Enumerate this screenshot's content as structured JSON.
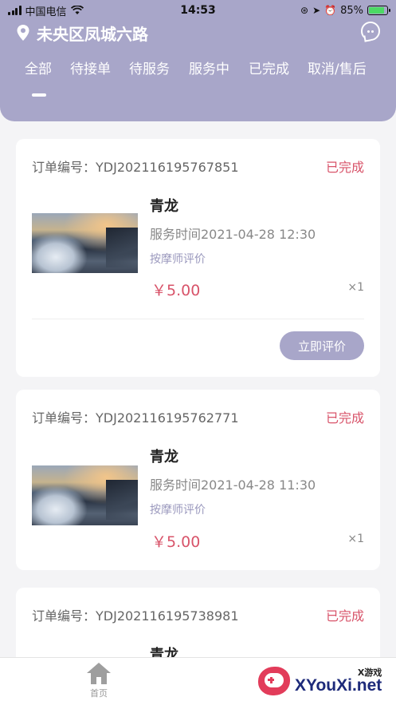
{
  "status_bar": {
    "carrier": "中国电信",
    "time": "14:53",
    "battery": "85%",
    "battery_level": 0.85
  },
  "header": {
    "location": "未央区凤城六路",
    "location_icon": "map-pin-icon",
    "chat_icon": "chat-bubble-icon"
  },
  "tabs": [
    {
      "label": "全部",
      "active": true
    },
    {
      "label": "待接单",
      "active": false
    },
    {
      "label": "待服务",
      "active": false
    },
    {
      "label": "服务中",
      "active": false
    },
    {
      "label": "已完成",
      "active": false
    },
    {
      "label": "取消/售后",
      "active": false
    }
  ],
  "orders": [
    {
      "order_label": "订单编号：YDJ202116195767851",
      "status": "已完成",
      "service_name": "青龙",
      "service_time": "服务时间2021-04-28 12:30",
      "review_link": "按摩师评价",
      "price": "￥5.00",
      "qty": "×1",
      "action": "立即评价"
    },
    {
      "order_label": "订单编号：YDJ202116195762771",
      "status": "已完成",
      "service_name": "青龙",
      "service_time": "服务时间2021-04-28 11:30",
      "review_link": "按摩师评价",
      "price": "￥5.00",
      "qty": "×1"
    },
    {
      "order_label": "订单编号：YDJ202116195738981",
      "status": "已完成",
      "service_name": "青龙"
    }
  ],
  "tabbar": {
    "home_label": "首页",
    "home_icon": "home-icon"
  },
  "watermark": {
    "small": "X游戏",
    "big": "XYouXi.net"
  },
  "colors": {
    "accent": "#a8a6c9",
    "status": "#d8546a",
    "background": "#f4f4f6"
  }
}
